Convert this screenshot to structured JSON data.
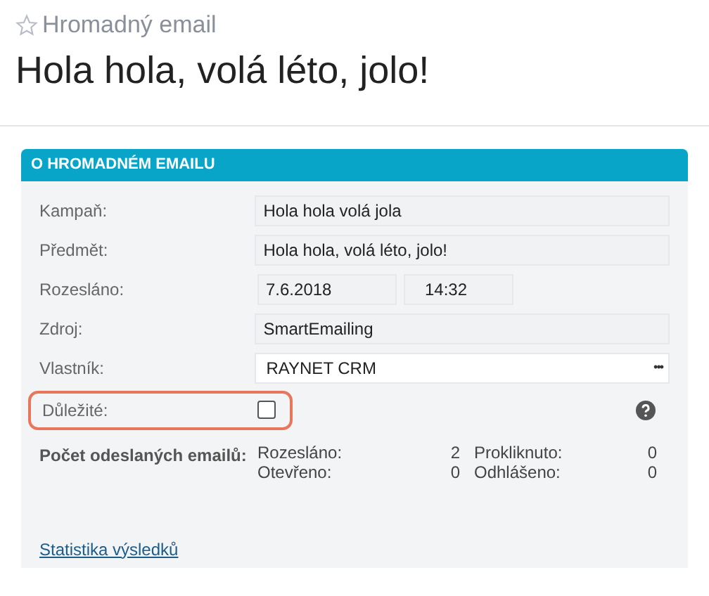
{
  "header": {
    "subtitle": "Hromadný email",
    "starred": false,
    "title": "Hola hola, volá léto, jolo!"
  },
  "panel": {
    "title": "O HROMADNÉM EMAILU",
    "fields": [
      {
        "kind": "text",
        "label": "Kampaň:",
        "value": "Hola hola volá jola"
      },
      {
        "kind": "text",
        "label": "Předmět:",
        "value": "Hola hola, volá léto, jolo!"
      },
      {
        "kind": "datetime",
        "label": "Rozesláno:",
        "date": "7.6.2018",
        "time": "14:32"
      },
      {
        "kind": "text",
        "label": "Zdroj:",
        "value": "SmartEmailing"
      },
      {
        "kind": "lookup",
        "label": "Vlastník:",
        "value": "RAYNET CRM",
        "button": "•••"
      }
    ],
    "important": {
      "label": "Důležité:",
      "checked": false,
      "highlighted": true
    },
    "stats": {
      "label": "Počet odeslaných emailů:",
      "items": [
        {
          "label": "Rozesláno:",
          "value": "2"
        },
        {
          "label": "Prokliknuto:",
          "value": "0"
        },
        {
          "label": "Otevřeno:",
          "value": "0"
        },
        {
          "label": "Odhlášeno:",
          "value": "0"
        }
      ]
    },
    "link": "Statistika výsledků"
  }
}
